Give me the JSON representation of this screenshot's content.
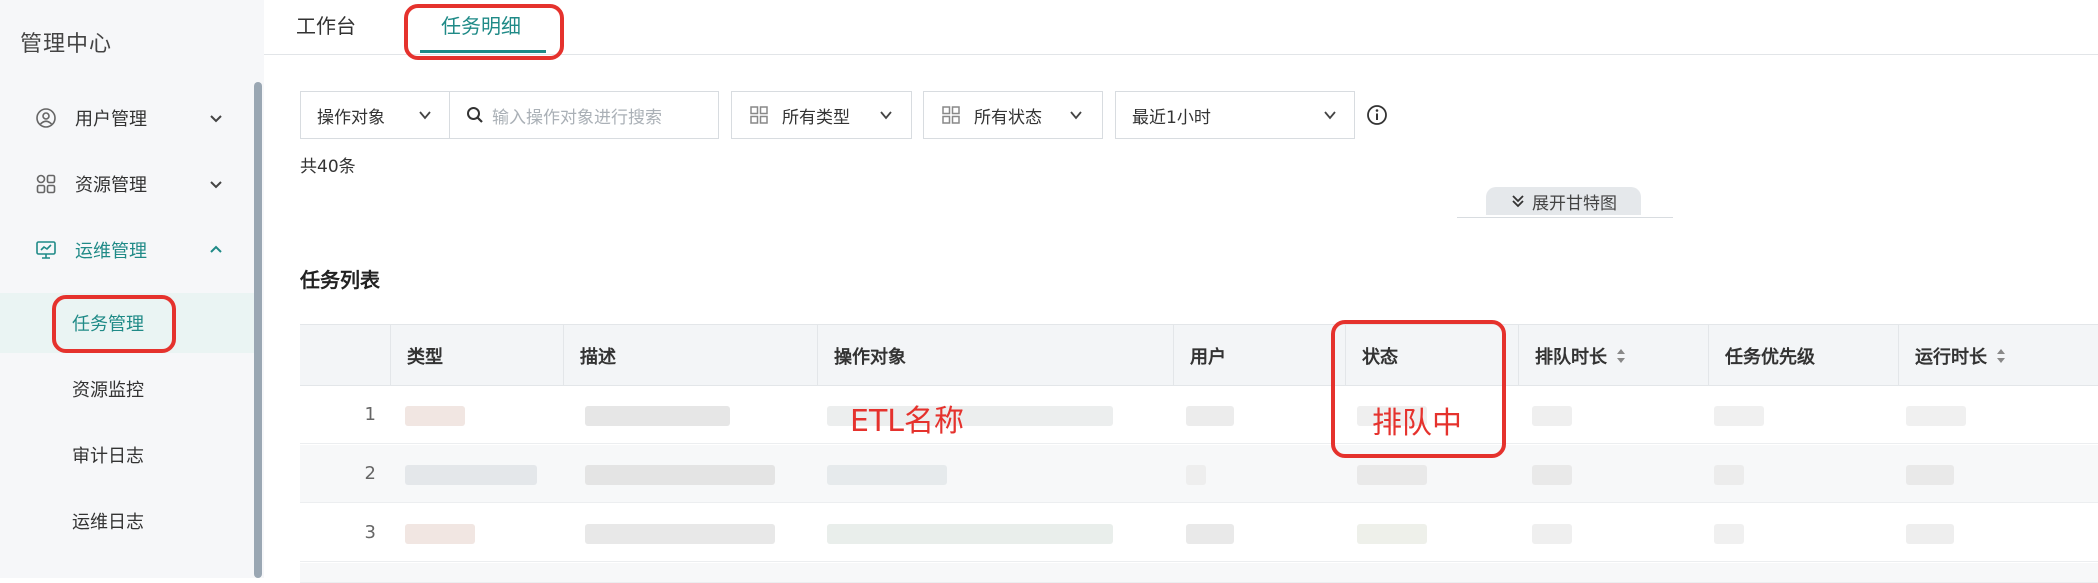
{
  "sidebar": {
    "title": "管理中心",
    "menus": [
      {
        "label": "用户管理",
        "icon": "user-icon",
        "expanded": false
      },
      {
        "label": "资源管理",
        "icon": "grid-icon",
        "expanded": false
      },
      {
        "label": "运维管理",
        "icon": "monitor-icon",
        "expanded": true
      }
    ],
    "submenus": [
      {
        "label": "任务管理",
        "selected": true
      },
      {
        "label": "资源监控",
        "selected": false
      },
      {
        "label": "审计日志",
        "selected": false
      },
      {
        "label": "运维日志",
        "selected": false
      }
    ]
  },
  "tabs": {
    "workbench": "工作台",
    "task_detail": "任务明细"
  },
  "filters": {
    "target_select": "操作对象",
    "search_placeholder": "输入操作对象进行搜索",
    "type_select": "所有类型",
    "status_select": "所有状态",
    "time_select": "最近1小时"
  },
  "total": "共40条",
  "gantt_toggle": "展开甘特图",
  "section_title": "任务列表",
  "table": {
    "columns": [
      "类型",
      "描述",
      "操作对象",
      "用户",
      "状态",
      "排队时长",
      "任务优先级",
      "运行时长"
    ],
    "rows": [
      {
        "index": "1"
      },
      {
        "index": "2"
      },
      {
        "index": "3"
      }
    ]
  },
  "annotations": {
    "etl_label": "ETL名称",
    "queue_label": "排队中"
  },
  "colors": {
    "accent": "#1f8a87",
    "annotation": "#e5322d",
    "sidebar_bg": "#f6f7f9"
  }
}
